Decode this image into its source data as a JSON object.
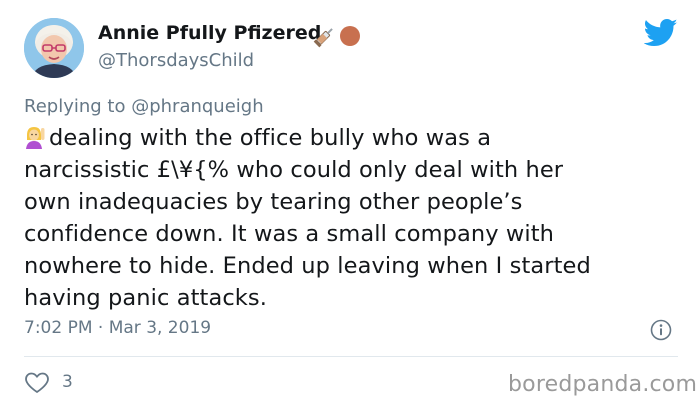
{
  "user": {
    "display_name": "Annie Pfully Pfizered",
    "handle": "@ThorsdaysChild",
    "avatar_icon": "avatar-woman-glasses",
    "name_badges": [
      "syringe-icon",
      "red-circle-icon"
    ]
  },
  "reply": {
    "prefix": "Replying to ",
    "mention": "@phranqueigh"
  },
  "body": {
    "emoji_icon": "woman-raising-hand-emoji",
    "lines": [
      "dealing with the office bully who was a",
      "narcissistic £\\¥{% who could only deal with her",
      "own inadequacies by tearing other people’s",
      "confidence down.  It was a small company with",
      "nowhere to hide.  Ended up leaving when I started",
      "having panic attacks."
    ]
  },
  "meta": {
    "timestamp": "7:02 PM · Mar 3, 2019",
    "info_icon": "info-icon"
  },
  "actions": {
    "like_icon": "heart-icon",
    "like_count": "3"
  },
  "watermark": "boredpanda.com",
  "colors": {
    "twitter_blue": "#1da1f2",
    "text_primary": "#14171a",
    "text_secondary": "#657786",
    "divider": "#e1e8ed"
  }
}
